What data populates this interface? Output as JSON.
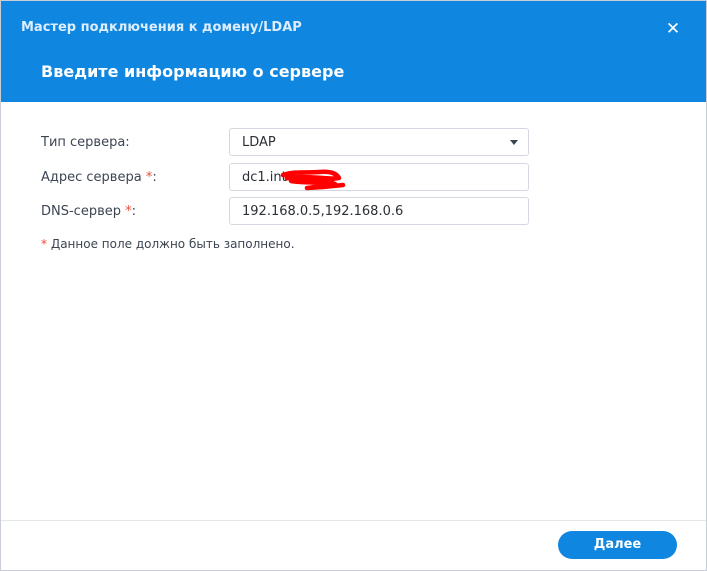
{
  "window": {
    "title": "Мастер подключения к домену/LDAP",
    "close_glyph": "✕"
  },
  "header": {
    "subtitle": "Введите информацию о сервере"
  },
  "form": {
    "server_type": {
      "label": "Тип сервера:",
      "value": "LDAP"
    },
    "server_address": {
      "label": "Адрес сервера",
      "required_mark": "*",
      "suffix": ":",
      "value": "dc1.int"
    },
    "dns_server": {
      "label": "DNS-сервер",
      "required_mark": "*",
      "suffix": ":",
      "value": "192.168.0.5,192.168.0.6"
    },
    "required_note": {
      "mark": "*",
      "text": " Данное поле должно быть заполнено."
    }
  },
  "footer": {
    "next_label": "Далее"
  },
  "colors": {
    "header_bg": "#0f86e0",
    "required_mark": "#f14a3a",
    "redaction": "#ff0000"
  },
  "icons": {
    "close": "close-icon",
    "dropdown": "chevron-down-icon"
  }
}
